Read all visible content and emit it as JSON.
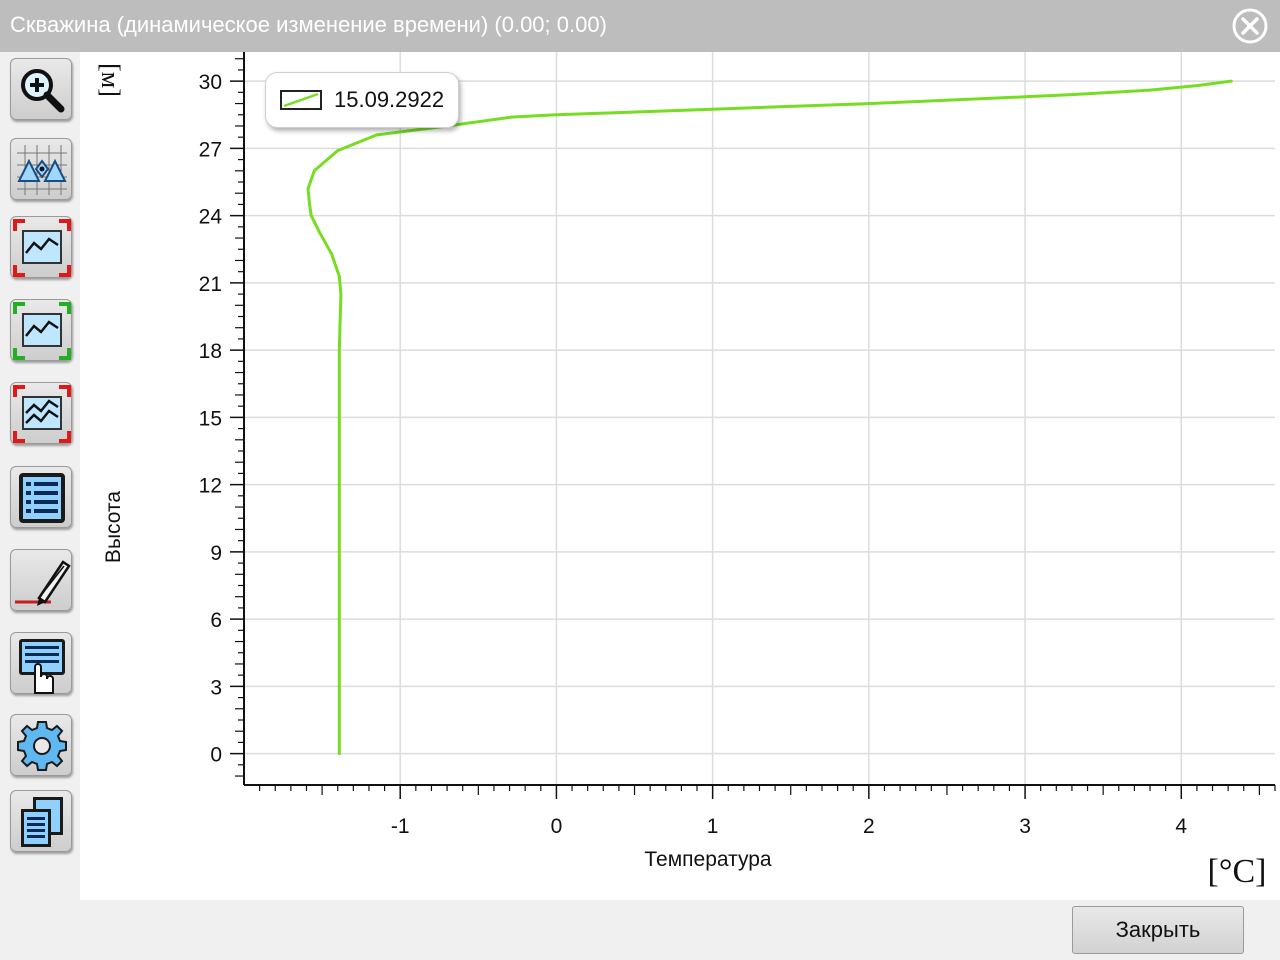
{
  "window": {
    "title": "Скважина (динамическое изменение времени) (0.00; 0.00)",
    "close_icon": "close-circle-icon"
  },
  "toolbar": {
    "items": [
      {
        "name": "zoom-in",
        "icon": "magnifier-plus-icon"
      },
      {
        "name": "markers",
        "icon": "triangle-markers-grid-icon"
      },
      {
        "name": "select-chart-red",
        "icon": "chart-frame-red-icon"
      },
      {
        "name": "select-chart-green",
        "icon": "chart-frame-green-icon"
      },
      {
        "name": "select-multi-chart",
        "icon": "multi-chart-frame-icon"
      },
      {
        "name": "list",
        "icon": "list-icon"
      },
      {
        "name": "edit",
        "icon": "pencil-icon"
      },
      {
        "name": "data-pick",
        "icon": "hand-pointer-table-icon"
      },
      {
        "name": "settings",
        "icon": "gear-icon"
      },
      {
        "name": "copy",
        "icon": "copy-pages-icon"
      }
    ]
  },
  "chart_data": {
    "type": "line",
    "xlabel": "Температура",
    "ylabel": "Высота",
    "x_unit": "[°C]",
    "y_unit": "[м]",
    "xlim": [
      -2.0,
      4.6
    ],
    "ylim": [
      -1.4,
      31.3
    ],
    "x_ticks": [
      "-1",
      "0",
      "1",
      "2",
      "3",
      "4"
    ],
    "y_ticks": [
      "0",
      "3",
      "6",
      "9",
      "12",
      "15",
      "18",
      "21",
      "24",
      "27",
      "30"
    ],
    "grid": true,
    "legend_position": "top-left",
    "series": [
      {
        "name": "15.09.2922",
        "color": "#77dd22",
        "points": [
          [
            -1.39,
            0
          ],
          [
            -1.39,
            3
          ],
          [
            -1.39,
            6
          ],
          [
            -1.39,
            9
          ],
          [
            -1.39,
            12
          ],
          [
            -1.39,
            15
          ],
          [
            -1.39,
            18
          ],
          [
            -1.38,
            20.5
          ],
          [
            -1.39,
            21.3
          ],
          [
            -1.44,
            22.3
          ],
          [
            -1.52,
            23.3
          ],
          [
            -1.57,
            24.0
          ],
          [
            -1.58,
            24.5
          ],
          [
            -1.59,
            25.2
          ],
          [
            -1.55,
            26.0
          ],
          [
            -1.4,
            26.9
          ],
          [
            -1.15,
            27.6
          ],
          [
            -0.7,
            28.0
          ],
          [
            -0.28,
            28.4
          ],
          [
            0.0,
            28.5
          ],
          [
            1.0,
            28.75
          ],
          [
            2.0,
            29.0
          ],
          [
            3.0,
            29.3
          ],
          [
            3.3,
            29.4
          ],
          [
            3.8,
            29.6
          ],
          [
            4.1,
            29.8
          ],
          [
            4.32,
            30.0
          ]
        ]
      }
    ]
  },
  "footer": {
    "close_label": "Закрыть"
  }
}
